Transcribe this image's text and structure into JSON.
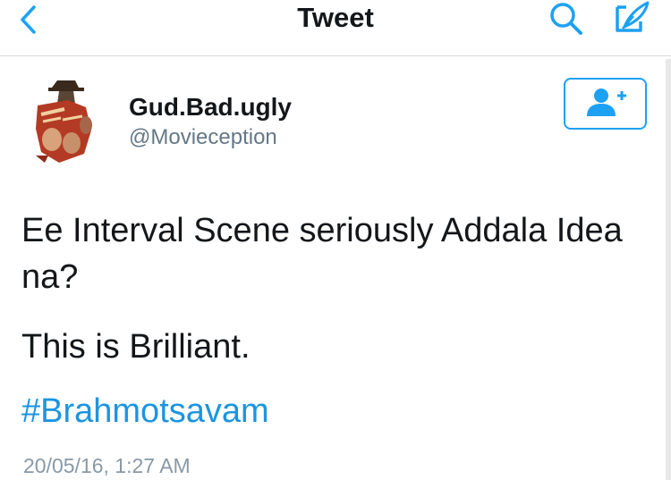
{
  "nav": {
    "title": "Tweet",
    "back_icon": "chevron-left-icon",
    "search_icon": "search-icon",
    "compose_icon": "compose-icon",
    "accent_color": "#1da1f2"
  },
  "author": {
    "display_name": "Gud.Bad.ugly",
    "handle": "@Movieception",
    "avatar": "movie-poster-avatar",
    "follow_icon": "add-user-icon"
  },
  "tweet": {
    "text": "Ee Interval Scene seriously Addala Idea na?",
    "second_line": "This is Brilliant.",
    "hashtag": "#Brahmotsavam",
    "timestamp": "20/05/16, 1:27 AM"
  }
}
